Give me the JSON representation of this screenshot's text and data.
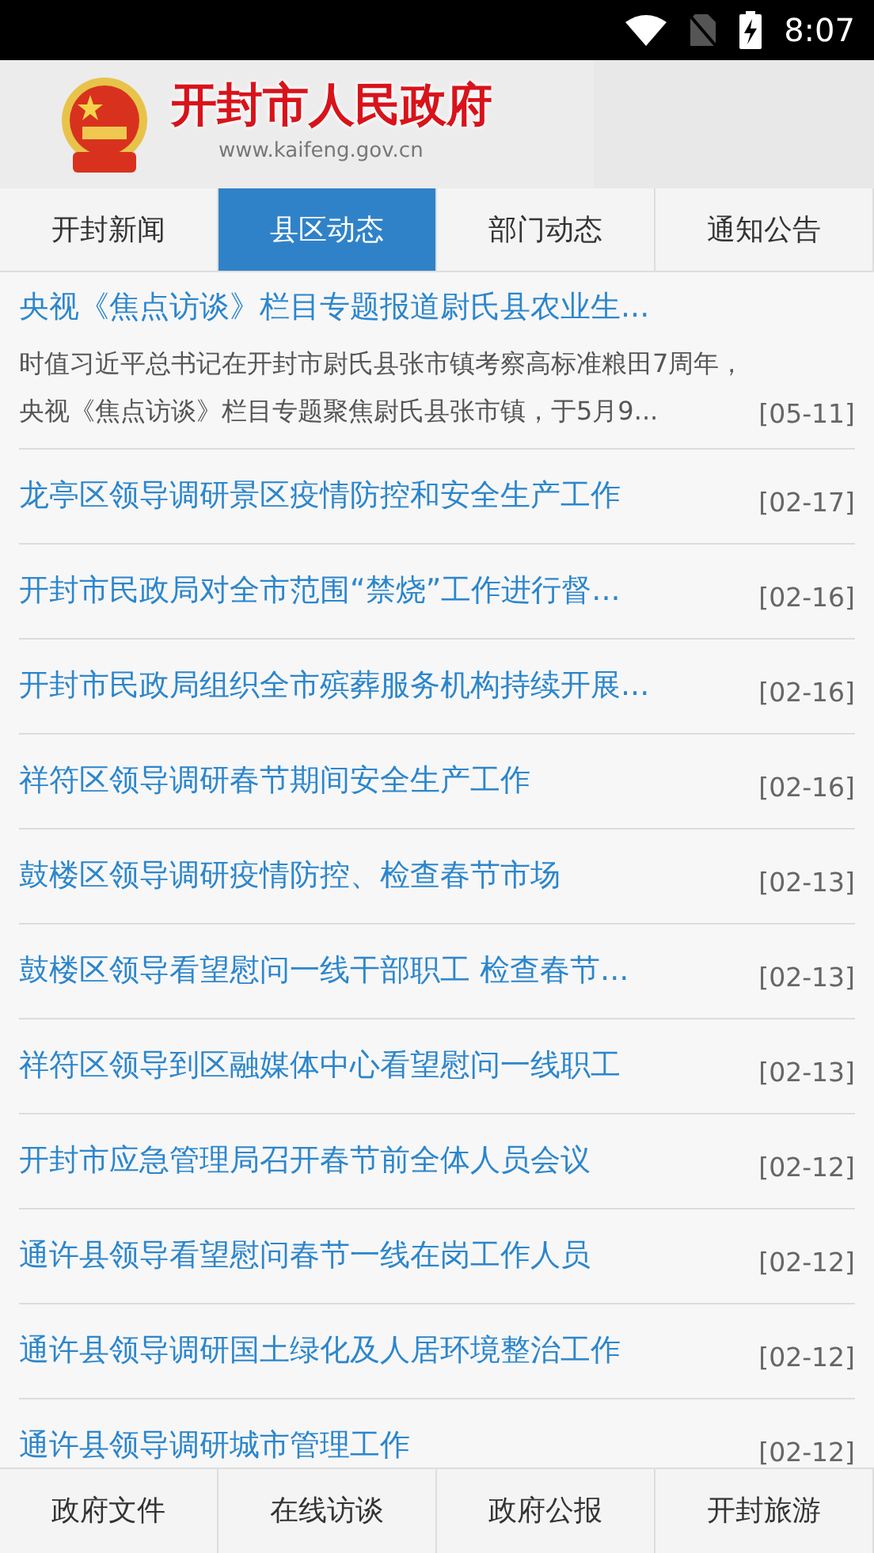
{
  "status_bar": {
    "time": "8:07"
  },
  "header": {
    "title": "开封市人民政府",
    "url": "www.kaifeng.gov.cn"
  },
  "tabs": [
    {
      "label": "开封新闻",
      "selected": false
    },
    {
      "label": "县区动态",
      "selected": true
    },
    {
      "label": "部门动态",
      "selected": false
    },
    {
      "label": "通知公告",
      "selected": false
    }
  ],
  "news": [
    {
      "title": "央视《焦点访谈》栏目专题报道尉氏县农业生...",
      "summary": "时值习近平总书记在开封市尉氏县张市镇考察高标准粮田7周年，央视《焦点访谈》栏目专题聚焦尉氏县张市镇，于5月9...",
      "date": "[05-11]"
    },
    {
      "title": "龙亭区领导调研景区疫情防控和安全生产工作",
      "date": "[02-17]"
    },
    {
      "title": "开封市民政局对全市范围“禁烧”工作进行督...",
      "date": "[02-16]"
    },
    {
      "title": "开封市民政局组织全市殡葬服务机构持续开展...",
      "date": "[02-16]"
    },
    {
      "title": "祥符区领导调研春节期间安全生产工作",
      "date": "[02-16]"
    },
    {
      "title": "鼓楼区领导调研疫情防控、检查春节市场",
      "date": "[02-13]"
    },
    {
      "title": "鼓楼区领导看望慰问一线干部职工 检查春节...",
      "date": "[02-13]"
    },
    {
      "title": "祥符区领导到区融媒体中心看望慰问一线职工",
      "date": "[02-13]"
    },
    {
      "title": "开封市应急管理局召开春节前全体人员会议",
      "date": "[02-12]"
    },
    {
      "title": "通许县领导看望慰问春节一线在岗工作人员",
      "date": "[02-12]"
    },
    {
      "title": "通许县领导调研国土绿化及人居环境整治工作",
      "date": "[02-12]"
    },
    {
      "title": "通许县领导调研城市管理工作",
      "date": "[02-12]"
    }
  ],
  "bottom_nav": [
    "政府文件",
    "在线访谈",
    "政府公报",
    "开封旅游"
  ]
}
